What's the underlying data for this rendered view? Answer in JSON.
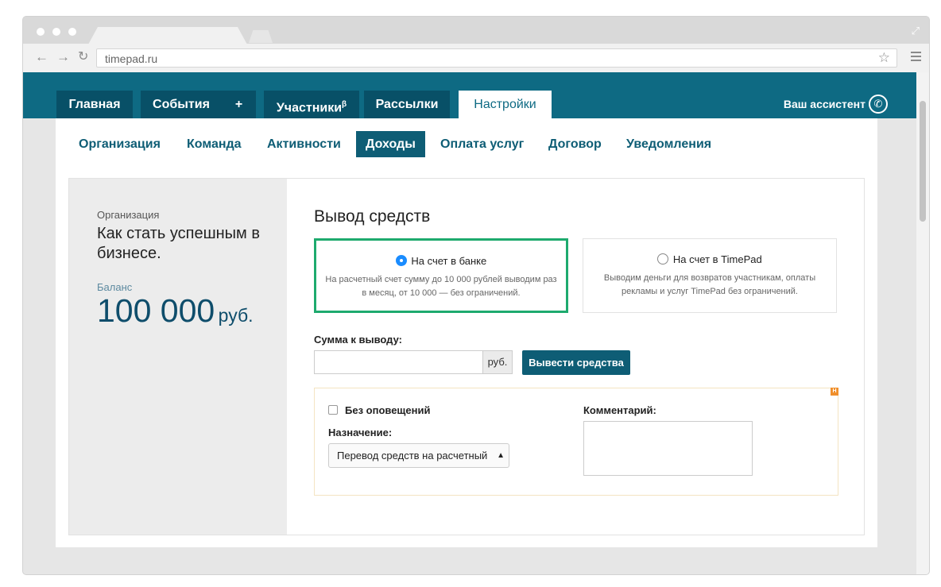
{
  "browser": {
    "url": "timepad.ru"
  },
  "top_nav": {
    "items": [
      {
        "label": "Главная"
      },
      {
        "label": "События"
      },
      {
        "label": "+"
      },
      {
        "label": "Участники",
        "sup": "β"
      },
      {
        "label": "Рассылки"
      },
      {
        "label": "Настройки",
        "active": true
      }
    ],
    "assistant": "Ваш ассистент"
  },
  "sub_nav": {
    "items": [
      {
        "label": "Организация"
      },
      {
        "label": "Команда"
      },
      {
        "label": "Активности"
      },
      {
        "label": "Доходы",
        "active": true
      },
      {
        "label": "Оплата услуг"
      },
      {
        "label": "Договор"
      },
      {
        "label": "Уведомления"
      }
    ]
  },
  "sidebar": {
    "org_label": "Организация",
    "org_name": "Как стать успешным в бизнесе.",
    "balance_label": "Баланс",
    "balance_value": "100 000",
    "balance_currency": "руб."
  },
  "withdraw": {
    "title": "Вывод средств",
    "option_bank": {
      "label": "На счет в банке",
      "desc": "На расчетный счет сумму до 10 000 рублей выводим раз в месяц, от 10 000 — без ограничений.",
      "selected": true
    },
    "option_timepad": {
      "label": "На счет в TimePad",
      "desc": "Выводим деньги для возвратов участникам, оплаты рекламы и услуг TimePad без ограничений.",
      "selected": false
    },
    "amount_label": "Сумма к выводу:",
    "amount_value": "",
    "amount_unit": "руб.",
    "submit_label": "Вывести средства",
    "badge": "H",
    "no_notify_label": "Без оповещений",
    "purpose_label": "Назначение:",
    "purpose_value": "Перевод средств на расчетный",
    "comment_label": "Комментарий:",
    "comment_value": ""
  },
  "colors": {
    "brand": "#0e6a83",
    "brand_dark": "#085067",
    "accent_green": "#1eaa6e",
    "radio_blue": "#1a8cff"
  }
}
